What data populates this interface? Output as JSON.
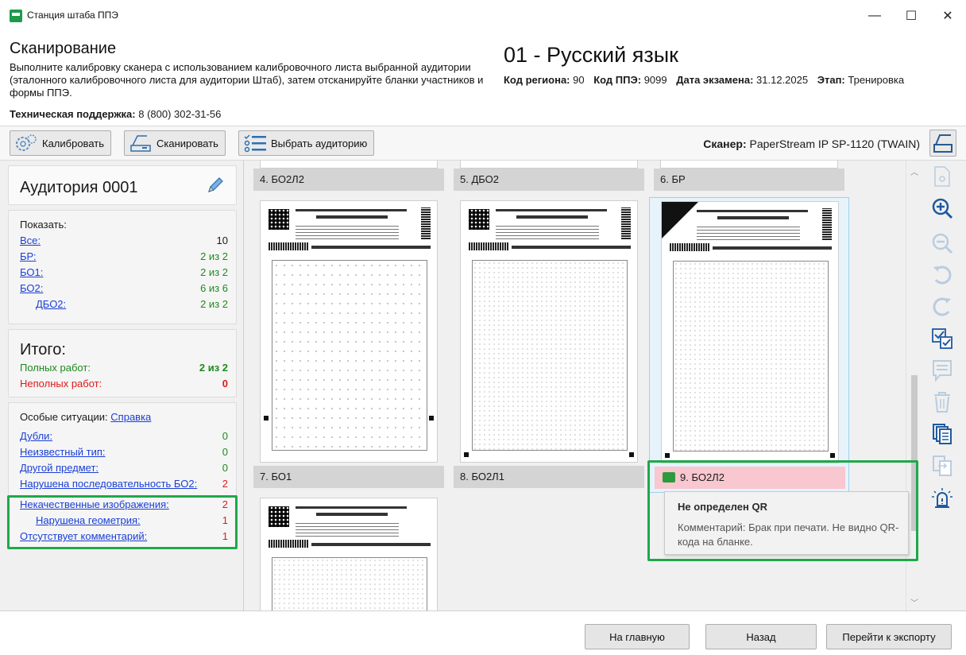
{
  "window": {
    "title": "Станция штаба ППЭ",
    "minimize_glyph": "—",
    "maximize_glyph": "☐",
    "close_glyph": "✕"
  },
  "header": {
    "title": "Сканирование",
    "description": "Выполните калибровку сканера с использованием калибровочного листа выбранной аудитории (эталонного калибровочного листа для аудитории Штаб), затем отсканируйте бланки участников и формы ППЭ.",
    "support_label": "Техническая поддержка:",
    "support_phone": "8 (800) 302-31-56",
    "subject": "01 - Русский язык",
    "region_label": "Код региона:",
    "region_value": "90",
    "ppe_label": "Код ППЭ:",
    "ppe_value": "9099",
    "date_label": "Дата экзамена:",
    "date_value": "31.12.2025",
    "stage_label": "Этап:",
    "stage_value": "Тренировка"
  },
  "toolbar": {
    "calibrate_label": "Калибровать",
    "scan_label": "Сканировать",
    "select_room_label": "Выбрать аудиторию",
    "scanner_label": "Сканер:",
    "scanner_value": "PaperStream IP SP-1120 (TWAIN)"
  },
  "sidebar": {
    "room_title": "Аудитория 0001",
    "show_label": "Показать:",
    "show_items": [
      {
        "label": "Все:",
        "value": "10"
      },
      {
        "label": "БР:",
        "value": "2 из 2"
      },
      {
        "label": "БО1:",
        "value": "2 из 2"
      },
      {
        "label": "БО2:",
        "value": "6 из 6"
      },
      {
        "label": "ДБО2:",
        "value": "2 из 2"
      }
    ],
    "total_title": "Итого:",
    "full_label": "Полных работ:",
    "full_value": "2 из 2",
    "incomplete_label": "Неполных работ:",
    "incomplete_value": "0",
    "special_label": "Особые ситуации:",
    "help_link": "Справка",
    "special_items": [
      {
        "label": "Дубли:",
        "value": "0"
      },
      {
        "label": "Неизвестный тип:",
        "value": "0"
      },
      {
        "label": "Другой предмет:",
        "value": "0"
      },
      {
        "label": "Нарушена последовательность БО2:",
        "value": "2"
      },
      {
        "label": "Некачественные изображения:",
        "value": "2"
      },
      {
        "label": "Нарушена геометрия:",
        "value": "1"
      },
      {
        "label": "Отсутствует комментарий:",
        "value": "1"
      }
    ]
  },
  "gallery": {
    "top_captions": [
      "4. БО2Л2",
      "5. ДБО2",
      "6. БР"
    ],
    "mid_captions": [
      "7. БО1",
      "8. БО2Л1",
      "9. БО2Л2"
    ]
  },
  "tooltip": {
    "title": "Не определен QR",
    "body": "Комментарий: Брак при печати. Не видно QR-кода на бланке."
  },
  "footer": {
    "home_label": "На главную",
    "back_label": "Назад",
    "export_label": "Перейти к экспорту"
  },
  "colors": {
    "highlight": "#1fa84a",
    "link": "#1a3fd6",
    "ok": "#1e8a1e",
    "error": "#e01a1a",
    "selected_caption": "#f8c7cf"
  }
}
